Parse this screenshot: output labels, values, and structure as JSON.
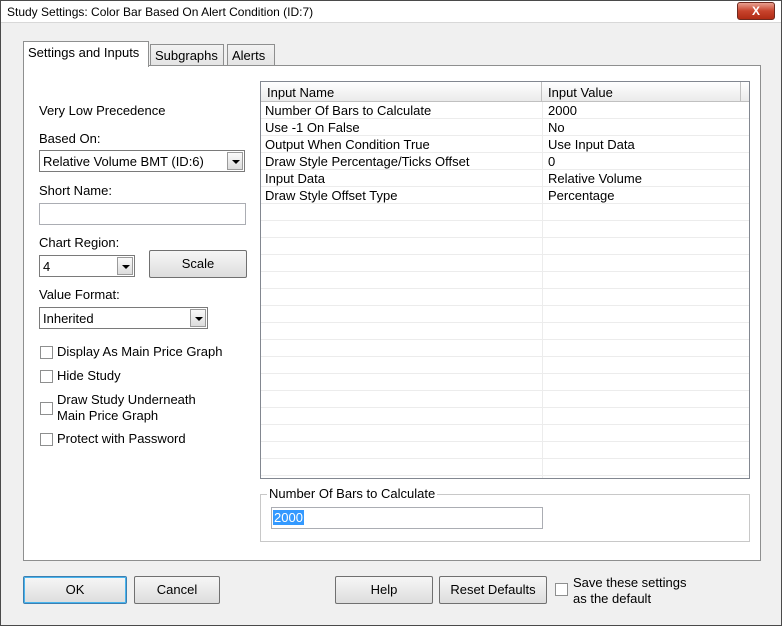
{
  "window": {
    "title": "Study Settings: Color Bar Based On Alert Condition (ID:7)",
    "close_label": "X"
  },
  "tabs": [
    {
      "label": "Settings and Inputs",
      "active": true
    },
    {
      "label": "Subgraphs",
      "active": false
    },
    {
      "label": "Alerts",
      "active": false
    }
  ],
  "left": {
    "precedence": "Very Low Precedence",
    "based_on_label": "Based On:",
    "based_on_value": "Relative Volume BMT (ID:6)",
    "short_name_label": "Short Name:",
    "short_name_value": "",
    "chart_region_label": "Chart Region:",
    "chart_region_value": "4",
    "scale_label": "Scale",
    "value_format_label": "Value Format:",
    "value_format_value": "Inherited",
    "checks": [
      {
        "label": "Display As Main Price Graph",
        "checked": false
      },
      {
        "label": "Hide Study",
        "checked": false
      },
      {
        "label": "Draw Study Underneath",
        "label2": "Main Price Graph",
        "checked": false
      },
      {
        "label": "Protect with Password",
        "checked": false
      }
    ]
  },
  "inputs": {
    "col_name": "Input Name",
    "col_value": "Input Value",
    "rows": [
      {
        "name": "Number Of Bars to Calculate",
        "value": "2000"
      },
      {
        "name": "Use -1 On False",
        "value": "No"
      },
      {
        "name": "Output When Condition True",
        "value": "Use Input Data"
      },
      {
        "name": "Draw Style Percentage/Ticks Offset",
        "value": "0"
      },
      {
        "name": "Input Data",
        "value": "Relative Volume"
      },
      {
        "name": "Draw Style Offset Type",
        "value": "Percentage"
      }
    ]
  },
  "edit_group": {
    "label": "Number Of Bars to Calculate",
    "value": "2000"
  },
  "footer": {
    "ok": "OK",
    "cancel": "Cancel",
    "help": "Help",
    "reset": "Reset Defaults",
    "save_default_line1": "Save these settings",
    "save_default_line2": "as the default"
  }
}
